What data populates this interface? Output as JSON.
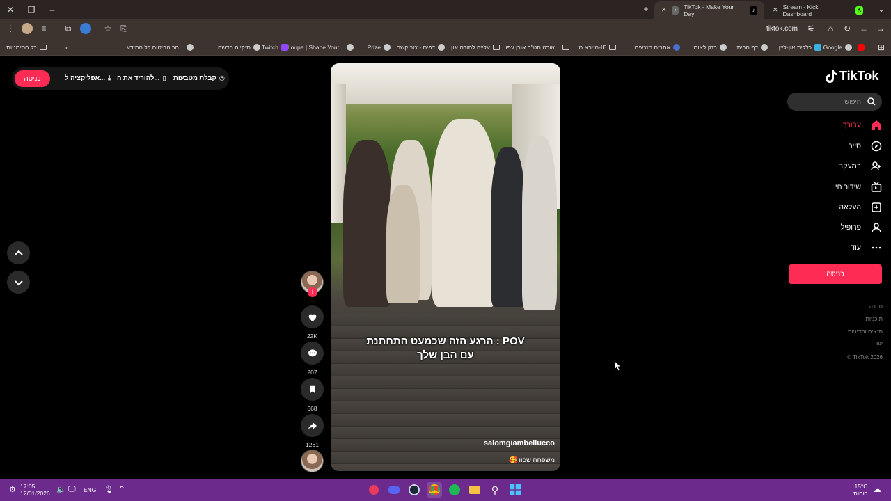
{
  "browser": {
    "tabs": [
      {
        "title": "TikTok - Make Your Day",
        "active": true
      },
      {
        "title": "Stream - Kick Dashboard",
        "active": false
      }
    ],
    "url": "tiktok.com",
    "bookmarks": [
      "Google",
      "כללית און-ליין",
      "דף הבית",
      "בנק לאומי",
      "אתרים מוצעים",
      "מייבא מ-IE",
      "אורט חט\"ב אורן עפו...",
      "עלייה לתורה יגון",
      "דפים - צור קשר",
      "Prize",
      "Loupe | Shape Your...",
      "Twitch",
      "תיקייה חדשה",
      "הר הביטוח כל המידע...",
      "כל הסימניות"
    ]
  },
  "header": {
    "login_label": "כניסה",
    "links": [
      "קבלת מטבעות",
      "להוריד את ה...",
      "אפליקציה ל..."
    ]
  },
  "video": {
    "caption_line1": "POV : הרגע הזה שכמעט התחתנת",
    "caption_line2": "עם הבן שלך",
    "username": "salomgiambellucco",
    "description": "משפחה שכזו 🥰"
  },
  "actions": {
    "likes": "22K",
    "comments": "207",
    "saves": "668",
    "shares": "1261"
  },
  "sidebar": {
    "logo_text": "TikTok",
    "search_placeholder": "חיפוש",
    "items": [
      {
        "label": "עבורך",
        "icon": "home-icon",
        "active": true
      },
      {
        "label": "סייר",
        "icon": "compass-icon",
        "active": false
      },
      {
        "label": "במעקב",
        "icon": "user-follow-icon",
        "active": false
      },
      {
        "label": "שידור חי",
        "icon": "live-tv-icon",
        "active": false
      },
      {
        "label": "העלאה",
        "icon": "upload-icon",
        "active": false
      },
      {
        "label": "פרופיל",
        "icon": "profile-icon",
        "active": false
      },
      {
        "label": "עוד",
        "icon": "more-icon",
        "active": false
      }
    ],
    "login_label": "כניסה",
    "footer": [
      "חברה",
      "תוכניות",
      "תנאים ומדיניות",
      "עוד",
      "TikTok 2026 ©"
    ]
  },
  "taskbar": {
    "time": "17:05",
    "date": "12/01/2026",
    "lang": "ENG",
    "weather_temp": "15°C",
    "weather_desc": "רוחות"
  },
  "colors": {
    "accent": "#fe2c55",
    "taskbar": "#6b2a8c",
    "chrome": "#3d3430"
  }
}
